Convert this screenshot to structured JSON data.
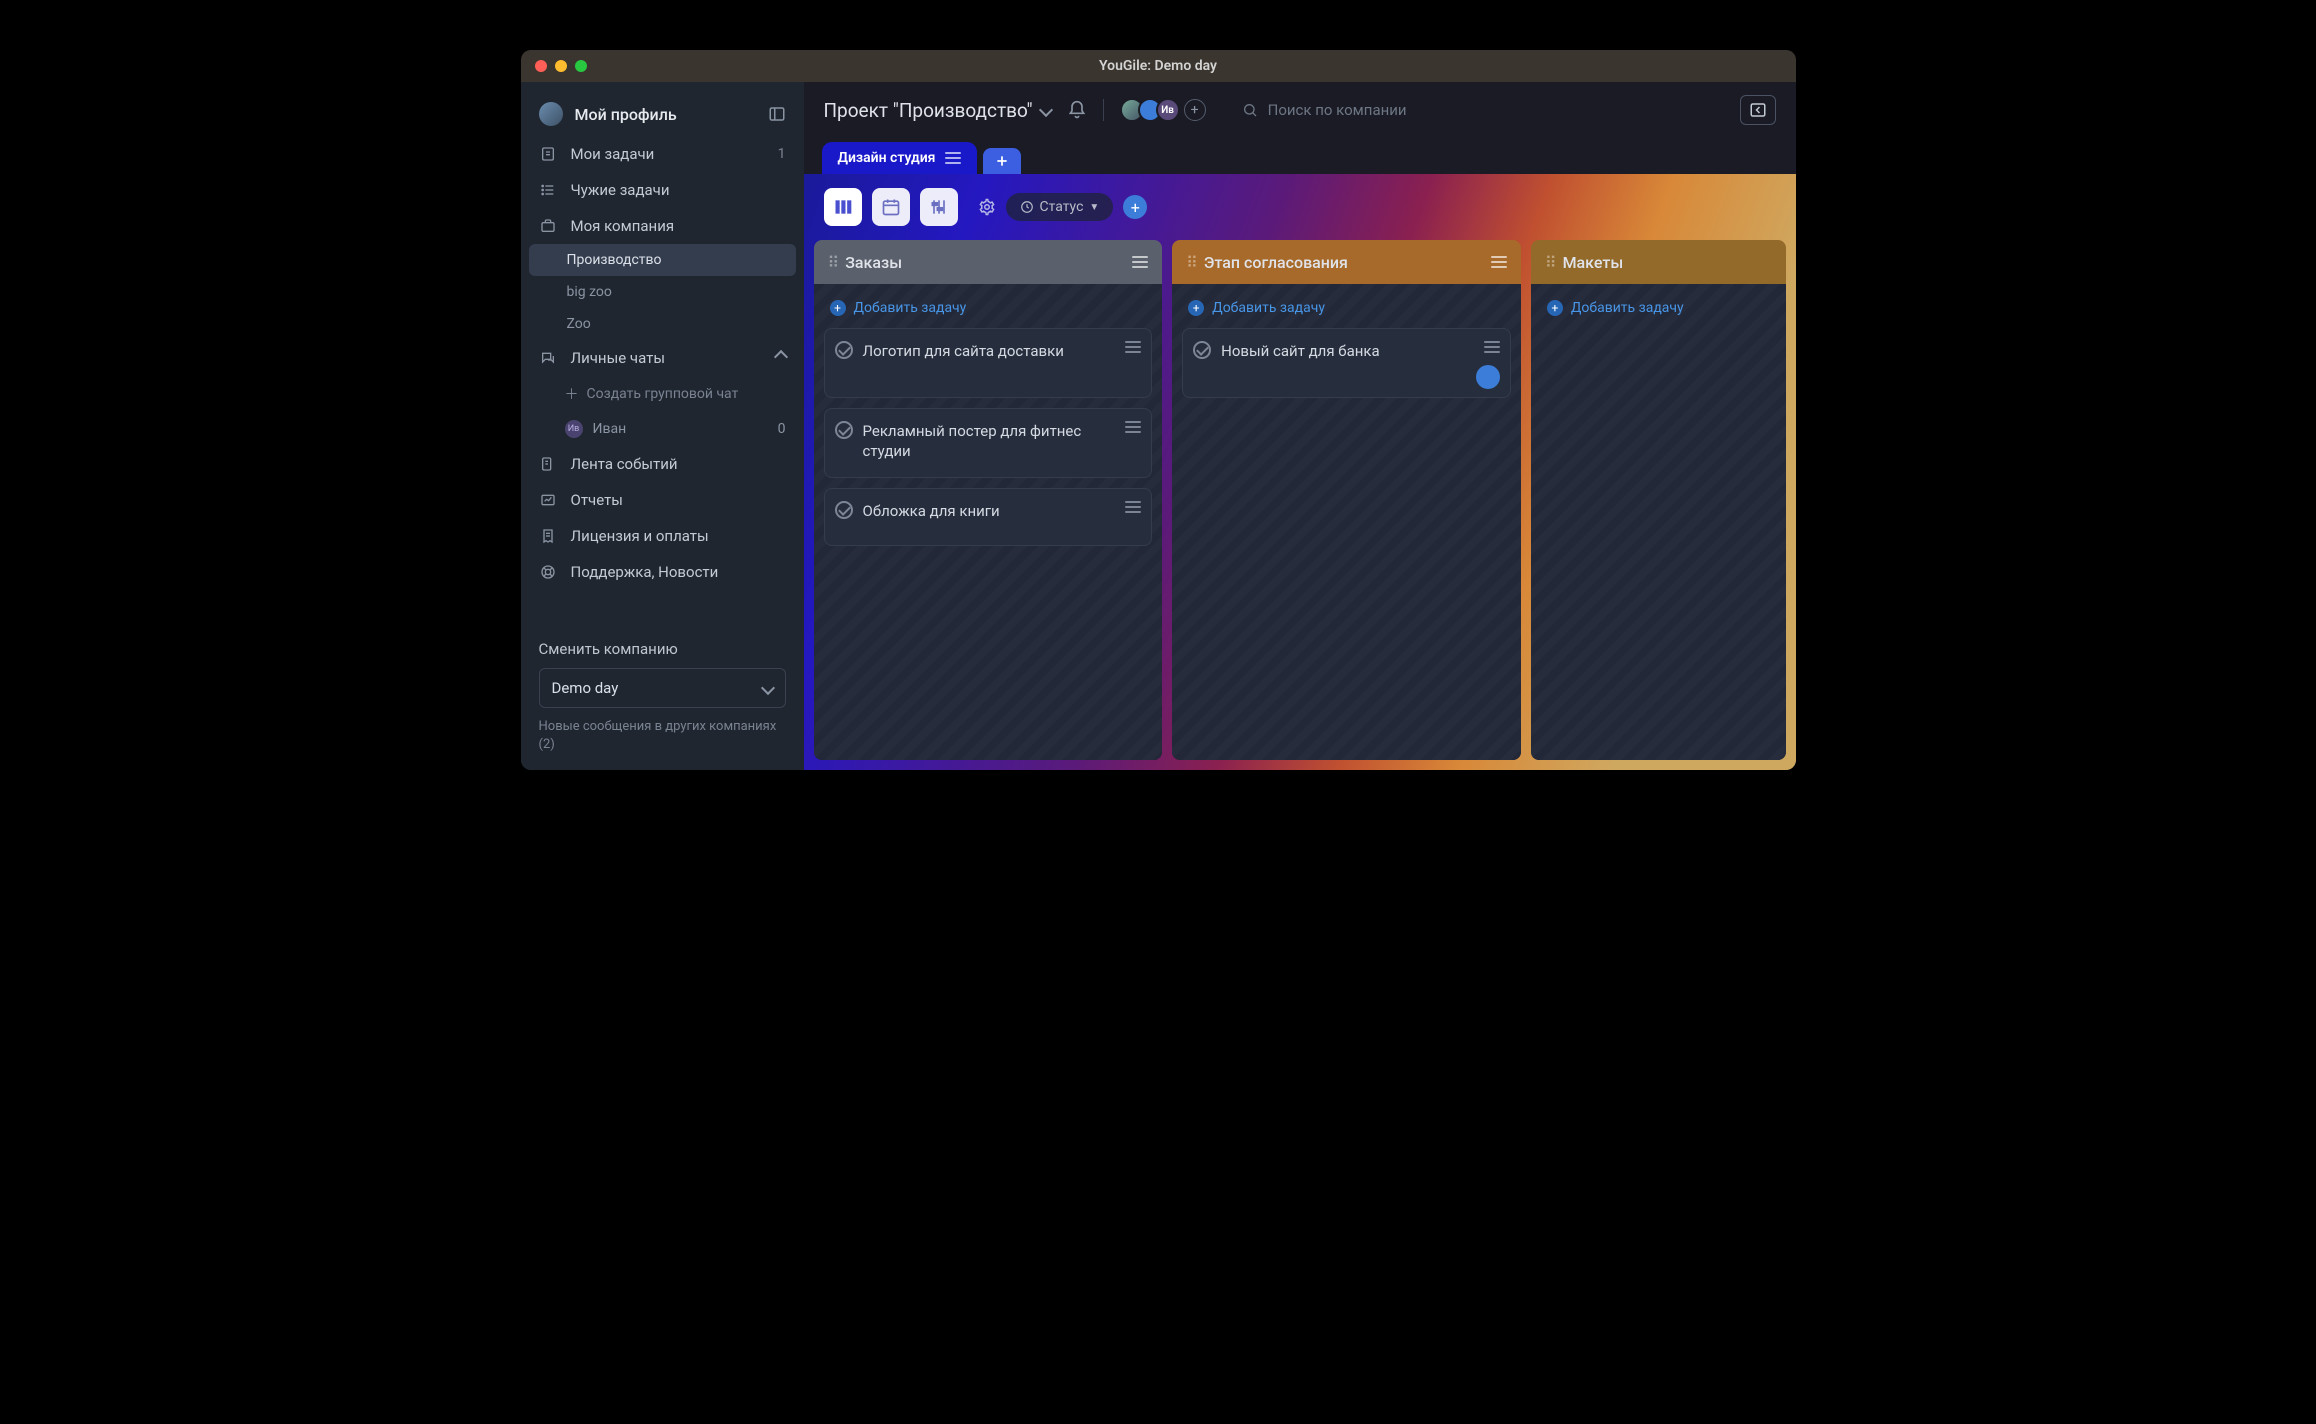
{
  "window": {
    "title": "YouGile: Demo day"
  },
  "sidebar": {
    "profile": "Мой профиль",
    "items": [
      {
        "label": "Мои задачи",
        "badge": "1"
      },
      {
        "label": "Чужие задачи"
      },
      {
        "label": "Моя компания"
      }
    ],
    "projects": [
      {
        "label": "Производство",
        "active": true
      },
      {
        "label": "big zoo"
      },
      {
        "label": "Zoo"
      }
    ],
    "chats_header": "Личные чаты",
    "create_group": "Создать групповой чат",
    "chat_user": {
      "initials": "Ив",
      "name": "Иван",
      "badge": "0"
    },
    "bottom": [
      {
        "label": "Лента событий"
      },
      {
        "label": "Отчеты"
      },
      {
        "label": "Лицензия и оплаты"
      },
      {
        "label": "Поддержка, Новости"
      }
    ],
    "switch_label": "Сменить компанию",
    "company": "Demo day",
    "new_msgs": "Новые сообщения в других компаниях (2)"
  },
  "header": {
    "project": "Проект \"Производство\"",
    "avatar_initials": "Ив",
    "search_placeholder": "Поиск по компании"
  },
  "tabs": {
    "active": "Дизайн студия"
  },
  "toolbar": {
    "status": "Статус"
  },
  "board": {
    "add_task": "Добавить задачу",
    "columns": [
      {
        "title": "Заказы",
        "cards": [
          {
            "title": "Логотип для сайта доставки"
          },
          {
            "title": "Рекламный постер для фитнес студии"
          },
          {
            "title": "Обложка для книги"
          }
        ]
      },
      {
        "title": "Этап согласования",
        "cards": [
          {
            "title": "Новый сайт для банка",
            "assignee": true
          }
        ]
      },
      {
        "title": "Макеты",
        "cards": []
      }
    ]
  }
}
